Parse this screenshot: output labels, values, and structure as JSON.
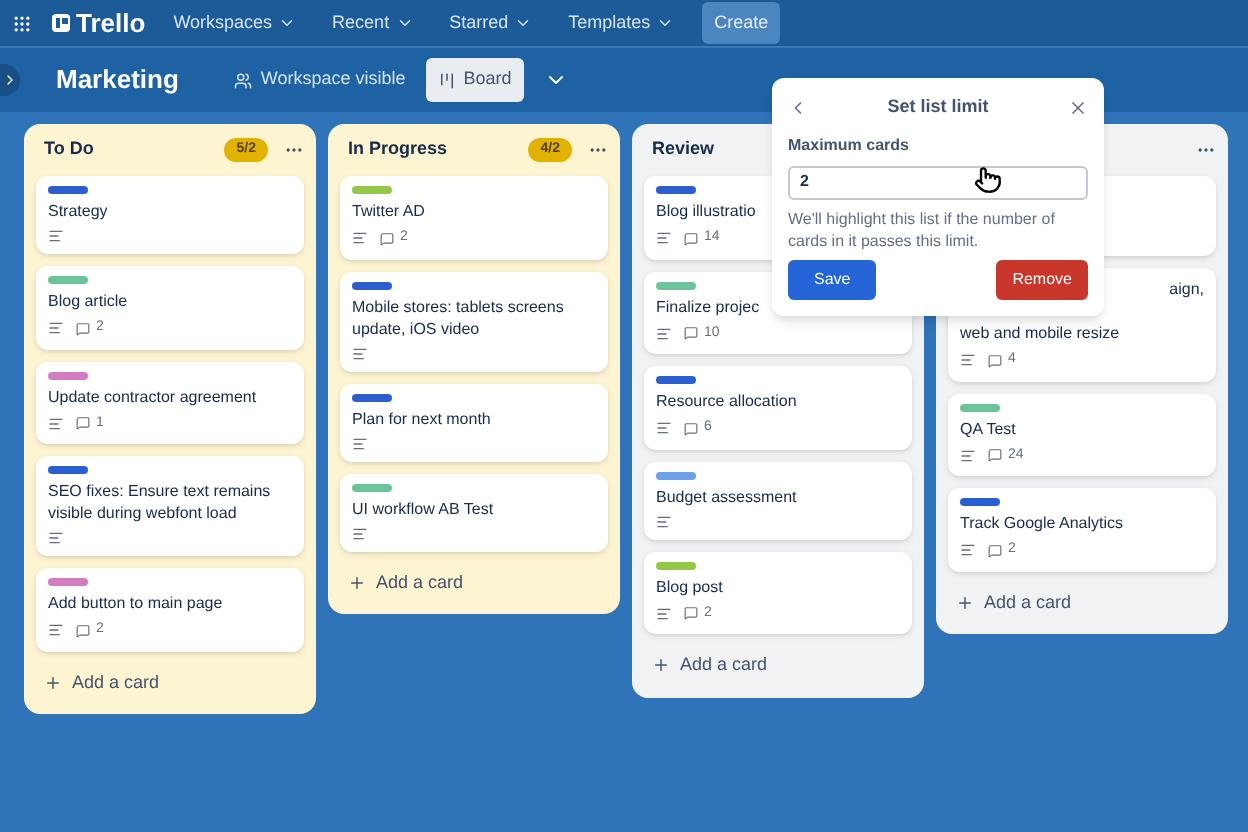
{
  "topbar": {
    "logo": "Trello",
    "menus": [
      "Workspaces",
      "Recent",
      "Starred",
      "Templates"
    ],
    "create": "Create"
  },
  "board_header": {
    "title": "Marketing",
    "visibility": "Workspace visible",
    "view": "Board"
  },
  "lists": [
    {
      "title": "To Do",
      "badge": "5/2",
      "highlighted": true,
      "menu": true,
      "add": "Add a card",
      "cards": [
        {
          "color": "#2b5fd0",
          "title": "Strategy"
        },
        {
          "color": "#6cc59a",
          "title": "Blog article",
          "comments": "2"
        },
        {
          "color": "#d37cbf",
          "title": "Update contractor agreement",
          "comments": "1"
        },
        {
          "color": "#2b5fd0",
          "title": "SEO fixes: Ensure text remains visible during webfont load"
        },
        {
          "color": "#d37cbf",
          "title": "Add button to main page",
          "comments": "2"
        }
      ]
    },
    {
      "title": "In Progress",
      "badge": "4/2",
      "highlighted": true,
      "menu": true,
      "add": "Add a card",
      "cards": [
        {
          "color": "#94c748",
          "title": "Twitter AD",
          "comments": "2"
        },
        {
          "color": "#2b5fd0",
          "title": "Mobile stores: tablets screens update, iOS video"
        },
        {
          "color": "#2b5fd0",
          "title": "Plan for next month"
        },
        {
          "color": "#6cc59a",
          "title": "UI workflow AB Test"
        }
      ]
    },
    {
      "title": "Review",
      "highlighted": false,
      "menu": false,
      "add": "Add a card",
      "cards": [
        {
          "color": "#2b5fd0",
          "title": "Blog illustratio",
          "comments": "14"
        },
        {
          "color": "#6cc59a",
          "title": "Finalize projec",
          "comments": "10"
        },
        {
          "color": "#2b5fd0",
          "title": "Resource allocation",
          "comments": "6"
        },
        {
          "color": "#6fa1e8",
          "title": "Budget assessment"
        },
        {
          "color": "#94c748",
          "title": "Blog post",
          "comments": "2"
        }
      ]
    },
    {
      "highlighted": false,
      "menu": true,
      "add": "Add a card",
      "cards": [
        {
          "kind": "covered"
        },
        {
          "kind": "partial",
          "tail": "aign,",
          "title": "web and mobile resize",
          "comments": "4"
        },
        {
          "color": "#6cc59a",
          "title": "QA Test",
          "comments": "24"
        },
        {
          "color": "#2b5fd0",
          "title": "Track Google Analytics",
          "comments": "2"
        }
      ]
    }
  ],
  "popup": {
    "title": "Set list limit",
    "label": "Maximum cards",
    "value": "2",
    "help": "We'll highlight this list if the number of cards in it passes this limit.",
    "save": "Save",
    "remove": "Remove"
  }
}
